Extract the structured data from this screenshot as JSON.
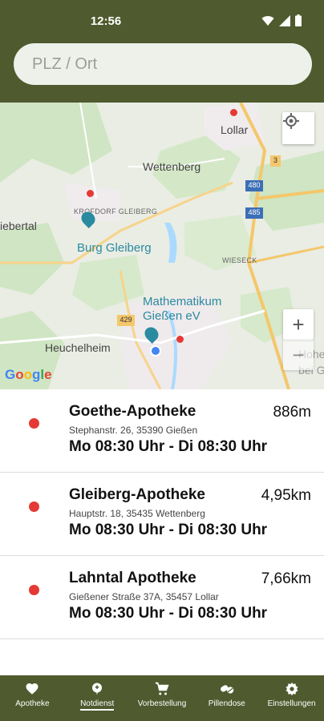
{
  "status_bar": {
    "time": "12:56"
  },
  "search": {
    "placeholder": "PLZ / Ort",
    "value": ""
  },
  "map": {
    "labels": {
      "lollar": "Lollar",
      "wettenberg": "Wettenberg",
      "krofdorf": "KROFDORF GLEIBERG",
      "biebertal": "iebertal",
      "burg": "Burg Gleiberg",
      "wieseck": "WIESECK",
      "mathematikum": "Mathematikum",
      "giessen_ev": "Gießen eV",
      "heuchelheim": "Heuchelheim",
      "hohe_warte": "Hohe War",
      "bei_giessen": "bei Gießen"
    },
    "road_numbers": {
      "r3": "3",
      "r480": "480",
      "r485": "485",
      "r429": "429"
    },
    "google": "Google",
    "zoom_in": "+",
    "zoom_out": "−"
  },
  "pharmacies": [
    {
      "name": "Goethe-Apotheke",
      "address": "Stephanstr. 26, 35390 Gießen",
      "hours": "Mo 08:30 Uhr - Di 08:30 Uhr",
      "distance": "886m"
    },
    {
      "name": "Gleiberg-Apotheke",
      "address": "Hauptstr. 18, 35435 Wettenberg",
      "hours": "Mo 08:30 Uhr - Di 08:30 Uhr",
      "distance": "4,95km"
    },
    {
      "name": "Lahntal Apotheke",
      "address": "Gießener Straße 37A, 35457 Lollar",
      "hours": "Mo 08:30 Uhr - Di 08:30 Uhr",
      "distance": "7,66km"
    }
  ],
  "bottom_nav": [
    {
      "label": "Apotheke",
      "icon": "heart-icon"
    },
    {
      "label": "Notdienst",
      "icon": "emergency-icon",
      "active": true
    },
    {
      "label": "Vorbestellung",
      "icon": "cart-icon"
    },
    {
      "label": "Pillendose",
      "icon": "pill-icon"
    },
    {
      "label": "Einstellungen",
      "icon": "gear-icon"
    }
  ],
  "colors": {
    "primary": "#4f5a2e",
    "pin": "#e53935"
  }
}
